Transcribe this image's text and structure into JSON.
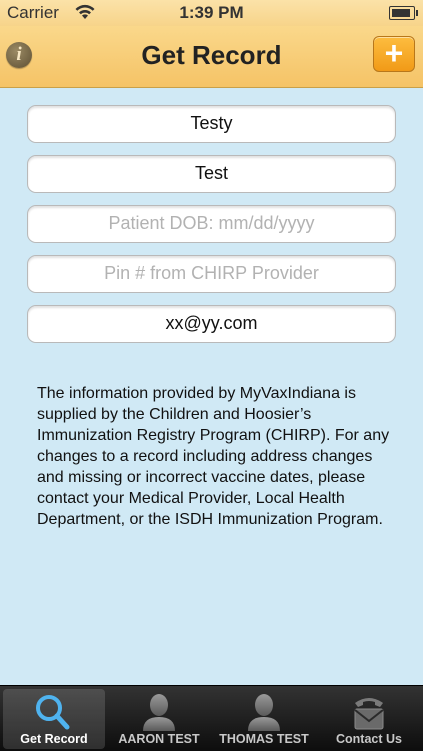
{
  "status_bar": {
    "carrier": "Carrier",
    "time": "1:39 PM"
  },
  "nav": {
    "title": "Get Record",
    "info_label": "i",
    "add_label": "+"
  },
  "form": {
    "first_name": {
      "value": "Testy",
      "placeholder": ""
    },
    "last_name": {
      "value": "Test",
      "placeholder": ""
    },
    "dob": {
      "value": "",
      "placeholder": "Patient DOB: mm/dd/yyyy"
    },
    "pin": {
      "value": "",
      "placeholder": "Pin # from CHIRP Provider"
    },
    "email": {
      "value": "xx@yy.com",
      "placeholder": ""
    }
  },
  "info_text": "The information provided by MyVaxIndiana is supplied by the Children and Hoosier’s Immunization Registry Program (CHIRP). For any changes to a record including address changes and missing or incorrect vaccine dates, please contact your Medical Provider, Local Health Department, or the ISDH Immunization Program.",
  "tabs": [
    {
      "label": "Get Record",
      "icon": "search-icon",
      "active": true
    },
    {
      "label": "AARON TEST",
      "icon": "person-icon",
      "active": false
    },
    {
      "label": "THOMAS TEST",
      "icon": "person-icon",
      "active": false
    },
    {
      "label": "Contact Us",
      "icon": "contact-phone-icon",
      "active": false
    }
  ],
  "colors": {
    "nav_bar": "#f5c366",
    "background": "#d0e9f5",
    "accent": "#f19a17",
    "search_icon": "#4fb3ef"
  }
}
